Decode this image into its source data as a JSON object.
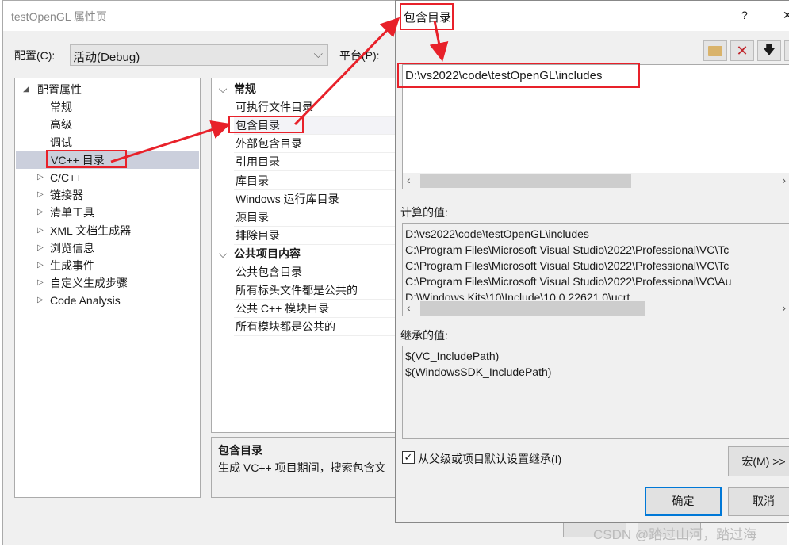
{
  "main": {
    "title": "testOpenGL 属性页",
    "config_label": "配置(C):",
    "config_value": "活动(Debug)",
    "platform_label": "平台(P):",
    "tree": [
      {
        "label": "配置属性",
        "expanded": true,
        "level": 0
      },
      {
        "label": "常规",
        "level": 1
      },
      {
        "label": "高级",
        "level": 1
      },
      {
        "label": "调试",
        "level": 1
      },
      {
        "label": "VC++ 目录",
        "level": 1,
        "selected": true
      },
      {
        "label": "C/C++",
        "level": 0
      },
      {
        "label": "链接器",
        "level": 0
      },
      {
        "label": "清单工具",
        "level": 0
      },
      {
        "label": "XML 文档生成器",
        "level": 0
      },
      {
        "label": "浏览信息",
        "level": 0
      },
      {
        "label": "生成事件",
        "level": 0
      },
      {
        "label": "自定义生成步骤",
        "level": 0
      },
      {
        "label": "Code Analysis",
        "level": 0
      }
    ],
    "grid": [
      {
        "label": "常规",
        "category": true
      },
      {
        "label": "可执行文件目录"
      },
      {
        "label": "包含目录",
        "selected": true
      },
      {
        "label": "外部包含目录"
      },
      {
        "label": "引用目录"
      },
      {
        "label": "库目录"
      },
      {
        "label": "Windows 运行库目录"
      },
      {
        "label": "源目录"
      },
      {
        "label": "排除目录"
      },
      {
        "label": "公共项目内容",
        "category": true
      },
      {
        "label": "公共包含目录"
      },
      {
        "label": "所有标头文件都是公共的"
      },
      {
        "label": "公共 C++ 模块目录"
      },
      {
        "label": "所有模块都是公共的"
      }
    ],
    "description": {
      "title": "包含目录",
      "text": "生成 VC++ 项目期间，搜索包含文"
    }
  },
  "dialog": {
    "title": "包含目录",
    "help": "?",
    "close": "✕",
    "edit_value": "D:\\vs2022\\code\\testOpenGL\\includes",
    "computed_label": "计算的值:",
    "computed": [
      "D:\\vs2022\\code\\testOpenGL\\includes",
      "C:\\Program Files\\Microsoft Visual Studio\\2022\\Professional\\VC\\Tc",
      "C:\\Program Files\\Microsoft Visual Studio\\2022\\Professional\\VC\\Tc",
      "C:\\Program Files\\Microsoft Visual Studio\\2022\\Professional\\VC\\Au",
      "D:\\Windows Kits\\10\\Include\\10.0.22621.0\\ucrt"
    ],
    "inherited_label": "继承的值:",
    "inherited": [
      "$(VC_IncludePath)",
      "$(WindowsSDK_IncludePath)"
    ],
    "inherit_checkbox": "从父级或项目默认设置继承(I)",
    "inherit_checked": true,
    "macro_button": "宏(M) >>",
    "ok_button": "确定",
    "cancel_button": "取消"
  },
  "watermark": "CSDN @踏过山河，踏过海",
  "colors": {
    "annotation": "#e8212a",
    "selection": "#cbcfdc",
    "ok_border": "#0078d7"
  }
}
